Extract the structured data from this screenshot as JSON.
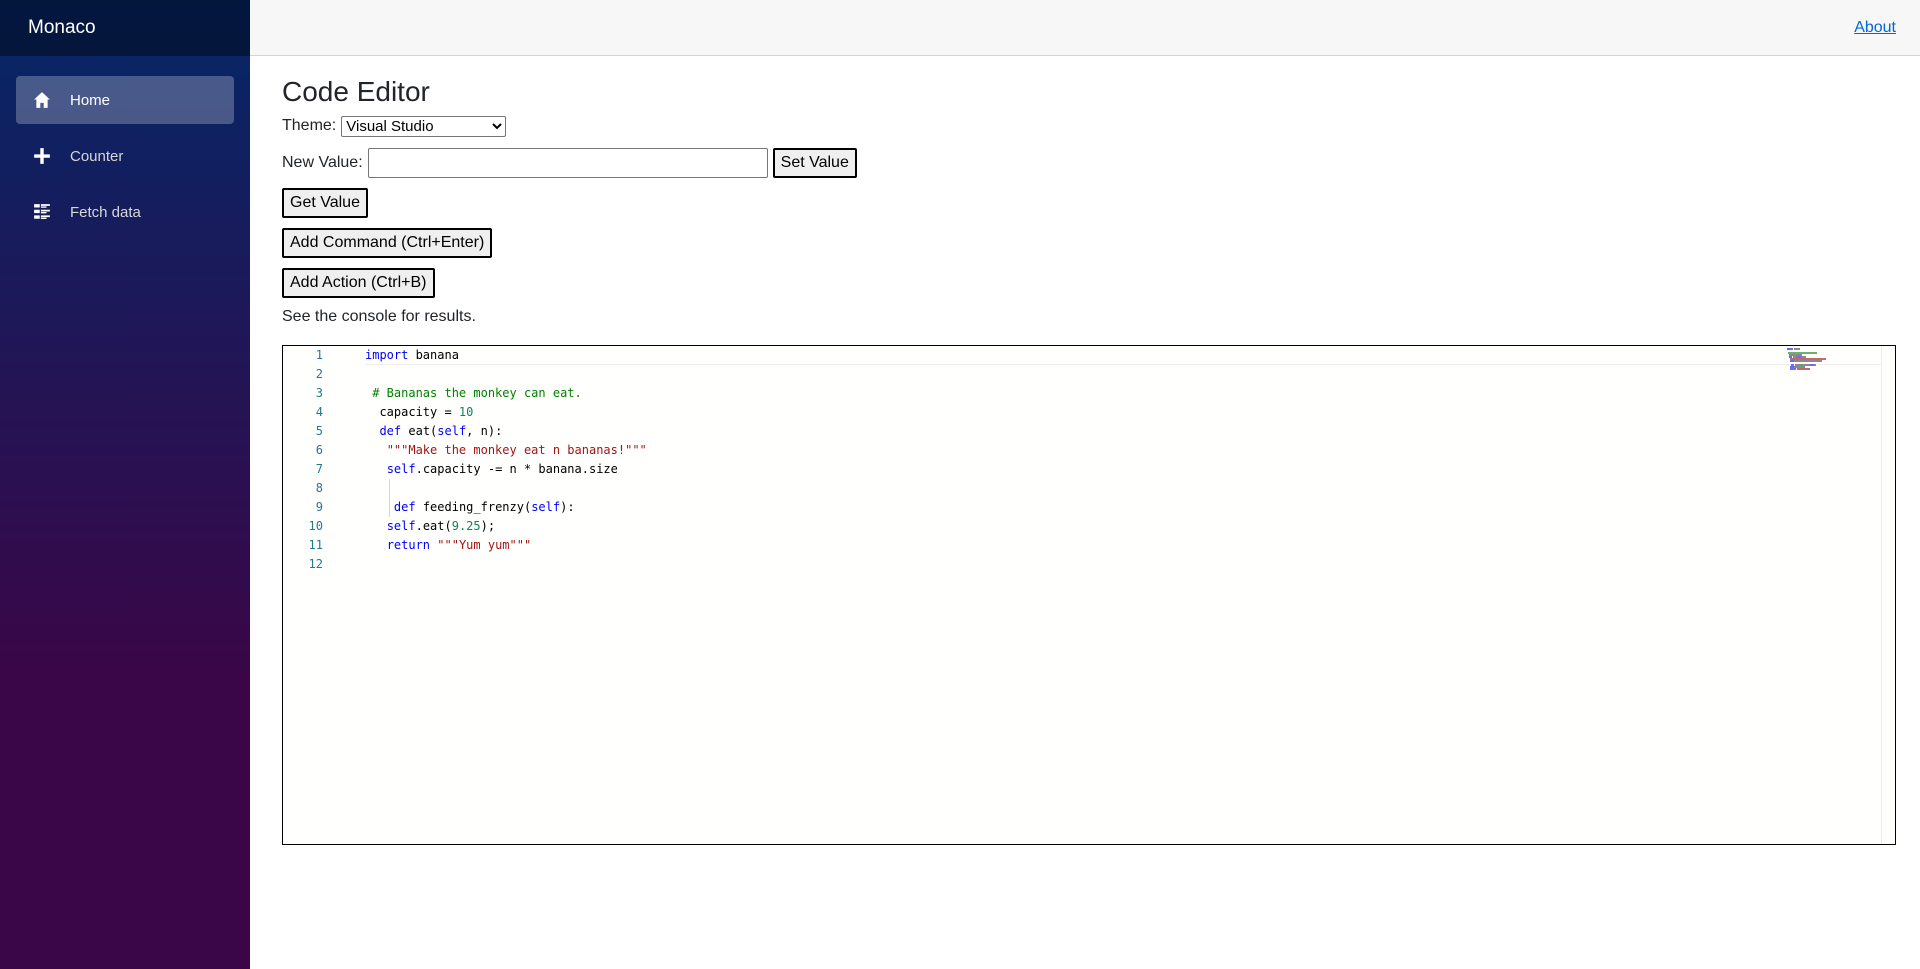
{
  "app": {
    "brand": "Monaco"
  },
  "sidebar": {
    "items": [
      {
        "label": "Home",
        "icon": "home-icon",
        "active": true
      },
      {
        "label": "Counter",
        "icon": "plus-icon",
        "active": false
      },
      {
        "label": "Fetch data",
        "icon": "list-icon",
        "active": false
      }
    ]
  },
  "topbar": {
    "about_label": "About"
  },
  "page": {
    "title": "Code Editor",
    "theme_label": "Theme:",
    "theme_selected": "Visual Studio",
    "new_value_label": "New Value:",
    "new_value": "",
    "set_value_label": "Set Value",
    "get_value_label": "Get Value",
    "add_command_label": "Add Command (Ctrl+Enter)",
    "add_action_label": "Add Action (Ctrl+B)",
    "hint": "See the console for results."
  },
  "editor": {
    "line_numbers": [
      "1",
      "2",
      "3",
      "4",
      "5",
      "6",
      "7",
      "8",
      "9",
      "10",
      "11",
      "12"
    ],
    "lines": [
      [
        {
          "t": "import",
          "c": "kw"
        },
        {
          "t": " banana",
          "c": ""
        }
      ],
      [],
      [
        {
          "t": " ",
          "c": ""
        },
        {
          "t": "# Bananas the monkey can eat.",
          "c": "cm"
        }
      ],
      [
        {
          "t": "  capacity = ",
          "c": ""
        },
        {
          "t": "10",
          "c": "num"
        }
      ],
      [
        {
          "t": "  ",
          "c": ""
        },
        {
          "t": "def",
          "c": "kw"
        },
        {
          "t": " eat(",
          "c": ""
        },
        {
          "t": "self",
          "c": "kw"
        },
        {
          "t": ", n):",
          "c": ""
        }
      ],
      [
        {
          "t": "   ",
          "c": ""
        },
        {
          "t": "\"\"\"Make the monkey eat n bananas!\"\"\"",
          "c": "str"
        }
      ],
      [
        {
          "t": "   ",
          "c": ""
        },
        {
          "t": "self",
          "c": "kw"
        },
        {
          "t": ".capacity -= n * banana.size",
          "c": ""
        }
      ],
      [],
      [
        {
          "t": "    ",
          "c": ""
        },
        {
          "t": "def",
          "c": "kw"
        },
        {
          "t": " feeding_frenzy(",
          "c": ""
        },
        {
          "t": "self",
          "c": "kw"
        },
        {
          "t": "):",
          "c": ""
        }
      ],
      [
        {
          "t": "   ",
          "c": ""
        },
        {
          "t": "self",
          "c": "kw"
        },
        {
          "t": ".eat(",
          "c": ""
        },
        {
          "t": "9.25",
          "c": "num"
        },
        {
          "t": ");",
          "c": ""
        }
      ],
      [
        {
          "t": "   ",
          "c": ""
        },
        {
          "t": "return",
          "c": "kw"
        },
        {
          "t": " ",
          "c": ""
        },
        {
          "t": "\"\"\"Yum yum\"\"\"",
          "c": "str"
        }
      ],
      []
    ]
  }
}
